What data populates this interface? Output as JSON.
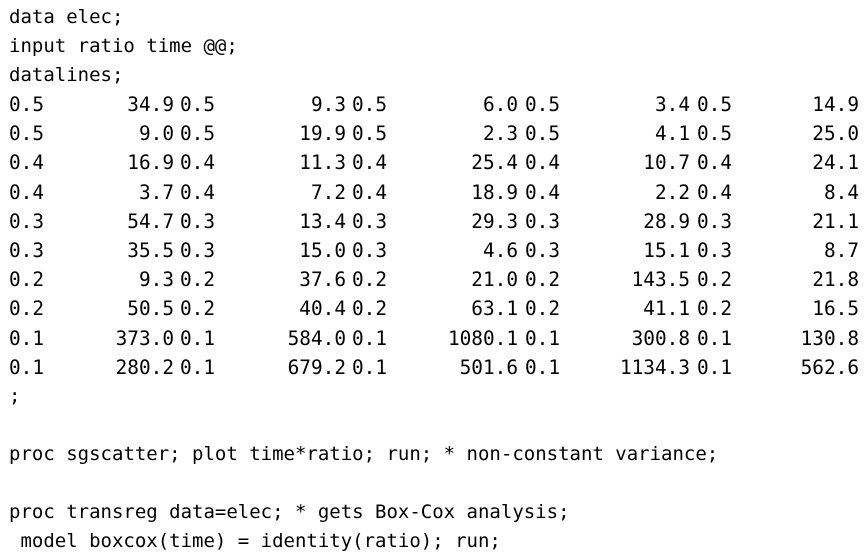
{
  "header_lines": [
    "data elec;",
    "input ratio time @@;",
    "datalines;"
  ],
  "data_rows": [
    [
      "0.5",
      "34.9",
      "0.5",
      "9.3",
      "0.5",
      "6.0",
      "0.5",
      "3.4",
      "0.5",
      "14.9"
    ],
    [
      "0.5",
      "9.0",
      "0.5",
      "19.9",
      "0.5",
      "2.3",
      "0.5",
      "4.1",
      "0.5",
      "25.0"
    ],
    [
      "0.4",
      "16.9",
      "0.4",
      "11.3",
      "0.4",
      "25.4",
      "0.4",
      "10.7",
      "0.4",
      "24.1"
    ],
    [
      "0.4",
      "3.7",
      "0.4",
      "7.2",
      "0.4",
      "18.9",
      "0.4",
      "2.2",
      "0.4",
      "8.4"
    ],
    [
      "0.3",
      "54.7",
      "0.3",
      "13.4",
      "0.3",
      "29.3",
      "0.3",
      "28.9",
      "0.3",
      "21.1"
    ],
    [
      "0.3",
      "35.5",
      "0.3",
      "15.0",
      "0.3",
      "4.6",
      "0.3",
      "15.1",
      "0.3",
      "8.7"
    ],
    [
      "0.2",
      "9.3",
      "0.2",
      "37.6",
      "0.2",
      "21.0",
      "0.2",
      "143.5",
      "0.2",
      "21.8"
    ],
    [
      "0.2",
      "50.5",
      "0.2",
      "40.4",
      "0.2",
      "63.1",
      "0.2",
      "41.1",
      "0.2",
      "16.5"
    ],
    [
      "0.1",
      "373.0",
      "0.1",
      "584.0",
      "0.1",
      "1080.1",
      "0.1",
      "300.8",
      "0.1",
      "130.8"
    ],
    [
      "0.1",
      "280.2",
      "0.1",
      "679.2",
      "0.1",
      "501.6",
      "0.1",
      "1134.3",
      "0.1",
      "562.6"
    ]
  ],
  "terminator": ";",
  "sgscatter_line": "proc sgscatter; plot time*ratio; run; * non-constant variance;",
  "transreg_line": "proc transreg data=elec; * gets Box-Cox analysis;",
  "model_line": " model boxcox(time) = identity(ratio); run;"
}
